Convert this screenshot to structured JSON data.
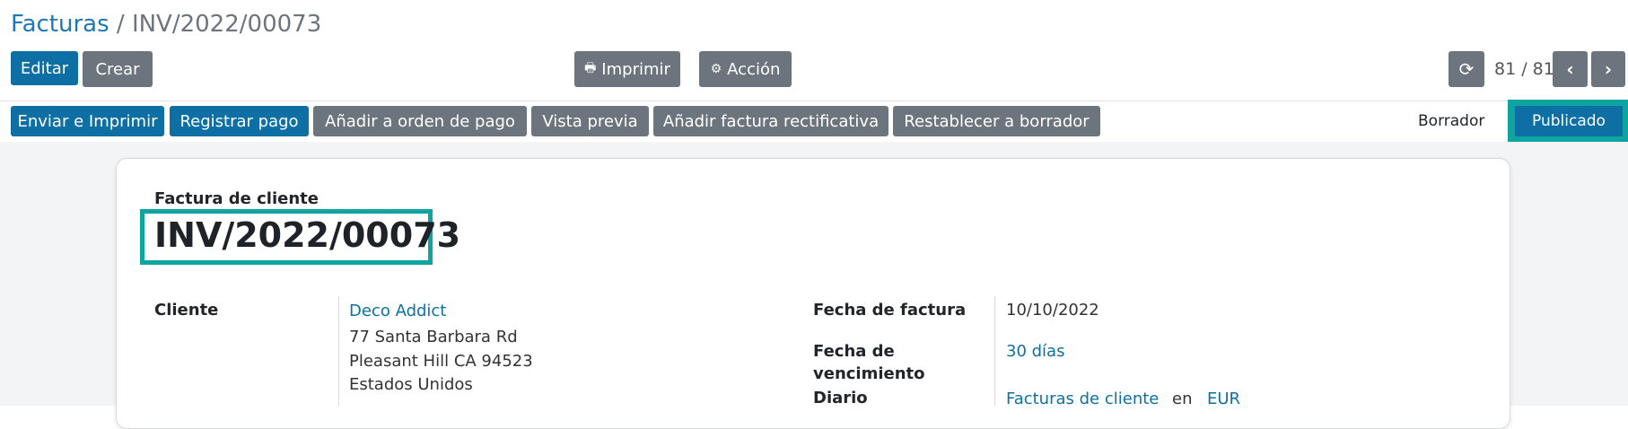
{
  "breadcrumb": {
    "parent": "Facturas",
    "separator": "/",
    "current": "INV/2022/00073"
  },
  "toolbar": {
    "edit_label": "Editar",
    "create_label": "Crear",
    "print_label": "Imprimir",
    "action_label": "Acción"
  },
  "pager": {
    "text": "81 / 81"
  },
  "header_buttons": {
    "send_print": "Enviar e Imprimir",
    "register_payment": "Registrar pago",
    "add_payment_order": "Añadir a orden de pago",
    "preview": "Vista previa",
    "add_credit_note": "Añadir factura rectificativa",
    "reset_draft": "Restablecer a borrador"
  },
  "status": {
    "draft": "Borrador",
    "posted": "Publicado"
  },
  "document": {
    "type": "Factura de cliente",
    "number": "INV/2022/00073"
  },
  "fields": {
    "customer_label": "Cliente",
    "customer_name": "Deco Addict",
    "customer_address_1": "77 Santa Barbara Rd",
    "customer_address_2": "Pleasant Hill CA 94523",
    "customer_address_3": "Estados Unidos",
    "invoice_date_label": "Fecha de factura",
    "invoice_date": "10/10/2022",
    "due_date_label_1": "Fecha de",
    "due_date_label_2": "vencimiento",
    "due_terms": "30 días",
    "journal_label": "Diario",
    "journal_value": "Facturas de cliente",
    "journal_in": "en",
    "currency": "EUR"
  },
  "icons": {
    "print": "printer-icon",
    "action": "gear-icon",
    "refresh": "refresh-icon",
    "prev": "chevron-left-icon",
    "next": "chevron-right-icon"
  },
  "colors": {
    "primary": "#0e6fa4",
    "secondary": "#6c757d",
    "highlight": "#0ea5a0"
  }
}
